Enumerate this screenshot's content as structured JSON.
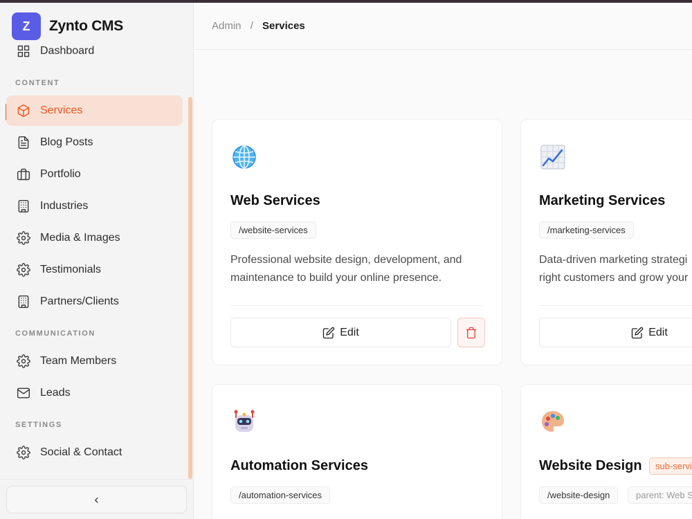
{
  "brand": {
    "logo_letter": "Z",
    "name": "Zynto CMS"
  },
  "sidebar": {
    "partial_item": "Dashboard",
    "sections": {
      "content": "CONTENT",
      "communication": "COMMUNICATION",
      "settings": "SETTINGS"
    },
    "items": [
      {
        "label": "Services",
        "icon": "box-icon",
        "active": true
      },
      {
        "label": "Blog Posts",
        "icon": "file-text-icon"
      },
      {
        "label": "Portfolio",
        "icon": "briefcase-icon"
      },
      {
        "label": "Industries",
        "icon": "building-icon"
      },
      {
        "label": "Media & Images",
        "icon": "gear-icon"
      },
      {
        "label": "Testimonials",
        "icon": "gear-icon"
      },
      {
        "label": "Partners/Clients",
        "icon": "building-icon"
      },
      {
        "label": "Team Members",
        "icon": "gear-icon"
      },
      {
        "label": "Leads",
        "icon": "mail-icon"
      },
      {
        "label": "Social & Contact",
        "icon": "gear-icon"
      }
    ],
    "collapse_glyph": "‹"
  },
  "header": {
    "breadcrumb_root": "Admin",
    "breadcrumb_sep": "/",
    "breadcrumb_current": "Services"
  },
  "cards": [
    {
      "emoji": "🌐",
      "title": "Web Services",
      "slug": "/website-services",
      "desc_line1": "Professional website design, development, and",
      "desc_line2": "maintenance to build your online presence.",
      "edit_label": "Edit"
    },
    {
      "emoji": "📈",
      "title": "Marketing Services",
      "slug": "/marketing-services",
      "desc_line1": "Data-driven marketing strategi",
      "desc_line2": "right customers and grow your",
      "edit_label": "Edit"
    },
    {
      "emoji": "🤖",
      "title": "Automation Services",
      "slug": "/automation-services"
    },
    {
      "emoji": "🎨",
      "title": "Website Design",
      "badge": "sub-servi",
      "slug": "/website-design",
      "parent": "parent: Web S"
    }
  ],
  "colors": {
    "accent": "#f0541e",
    "brand": "#5b5ce6",
    "danger": "#e0463a"
  }
}
